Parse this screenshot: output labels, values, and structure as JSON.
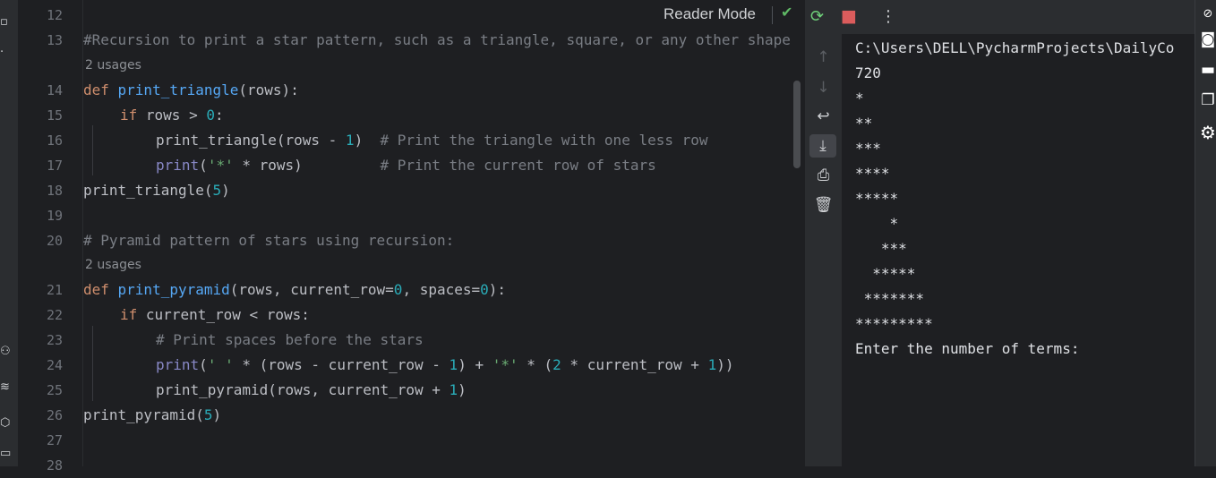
{
  "editor": {
    "reader_mode": "Reader Mode",
    "line_numbers": [
      "12",
      "13",
      "14",
      "15",
      "16",
      "17",
      "18",
      "19",
      "20",
      "21",
      "22",
      "23",
      "24",
      "25",
      "26",
      "27",
      "28"
    ],
    "usages": "2 usages",
    "code": {
      "l13": "#Recursion to print a star pattern, such as a triangle, square, or any other shape",
      "l14_kw": "def ",
      "l14_fn": "print_triangle",
      "l14_rest": "(rows):",
      "l15_kw": "if ",
      "l15_a": "rows > ",
      "l15_num": "0",
      "l15_b": ":",
      "l16_a": "print_triangle(rows - ",
      "l16_num": "1",
      "l16_b": ")  ",
      "l16_cm": "# Print the triangle with one less row",
      "l17_bi": "print",
      "l17_a": "(",
      "l17_str": "'*'",
      "l17_b": " * rows)         ",
      "l17_cm": "# Print the current row of stars",
      "l18_a": "print_triangle(",
      "l18_num": "5",
      "l18_b": ")",
      "l20_cm": "# Pyramid pattern of stars using recursion:",
      "l21_kw": "def ",
      "l21_fn": "print_pyramid",
      "l21_a": "(rows, current_row=",
      "l21_num1": "0",
      "l21_b": ", spaces=",
      "l21_num2": "0",
      "l21_c": "):",
      "l22_kw": "if ",
      "l22_a": "current_row < rows:",
      "l23_cm": "# Print spaces before the stars",
      "l24_bi": "print",
      "l24_a": "(",
      "l24_str1": "' '",
      "l24_b": " * (rows - current_row - ",
      "l24_num1": "1",
      "l24_c": ") + ",
      "l24_str2": "'*'",
      "l24_d": " * (",
      "l24_num2": "2",
      "l24_e": " * current_row + ",
      "l24_num3": "1",
      "l24_f": "))",
      "l25_a": "print_pyramid(rows, current_row + ",
      "l25_num": "1",
      "l25_b": ")",
      "l26_a": "print_pyramid(",
      "l26_num": "5",
      "l26_b": ")"
    }
  },
  "console": {
    "lines": [
      "C:\\Users\\DELL\\PycharmProjects\\DailyCo",
      "720",
      "*",
      "**",
      "***",
      "****",
      "*****",
      "    *",
      "   ***",
      "  *****",
      " *******",
      "*********",
      "Enter the number of terms:"
    ]
  },
  "icons": {
    "check": "✔",
    "rerun": "⟳",
    "stop": "■",
    "more": "⋮",
    "up": "↑",
    "down": "↓",
    "wrap": "↩",
    "scroll_end": "⤓",
    "print": "⎙",
    "trash": "🗑",
    "gear": "⚙"
  }
}
